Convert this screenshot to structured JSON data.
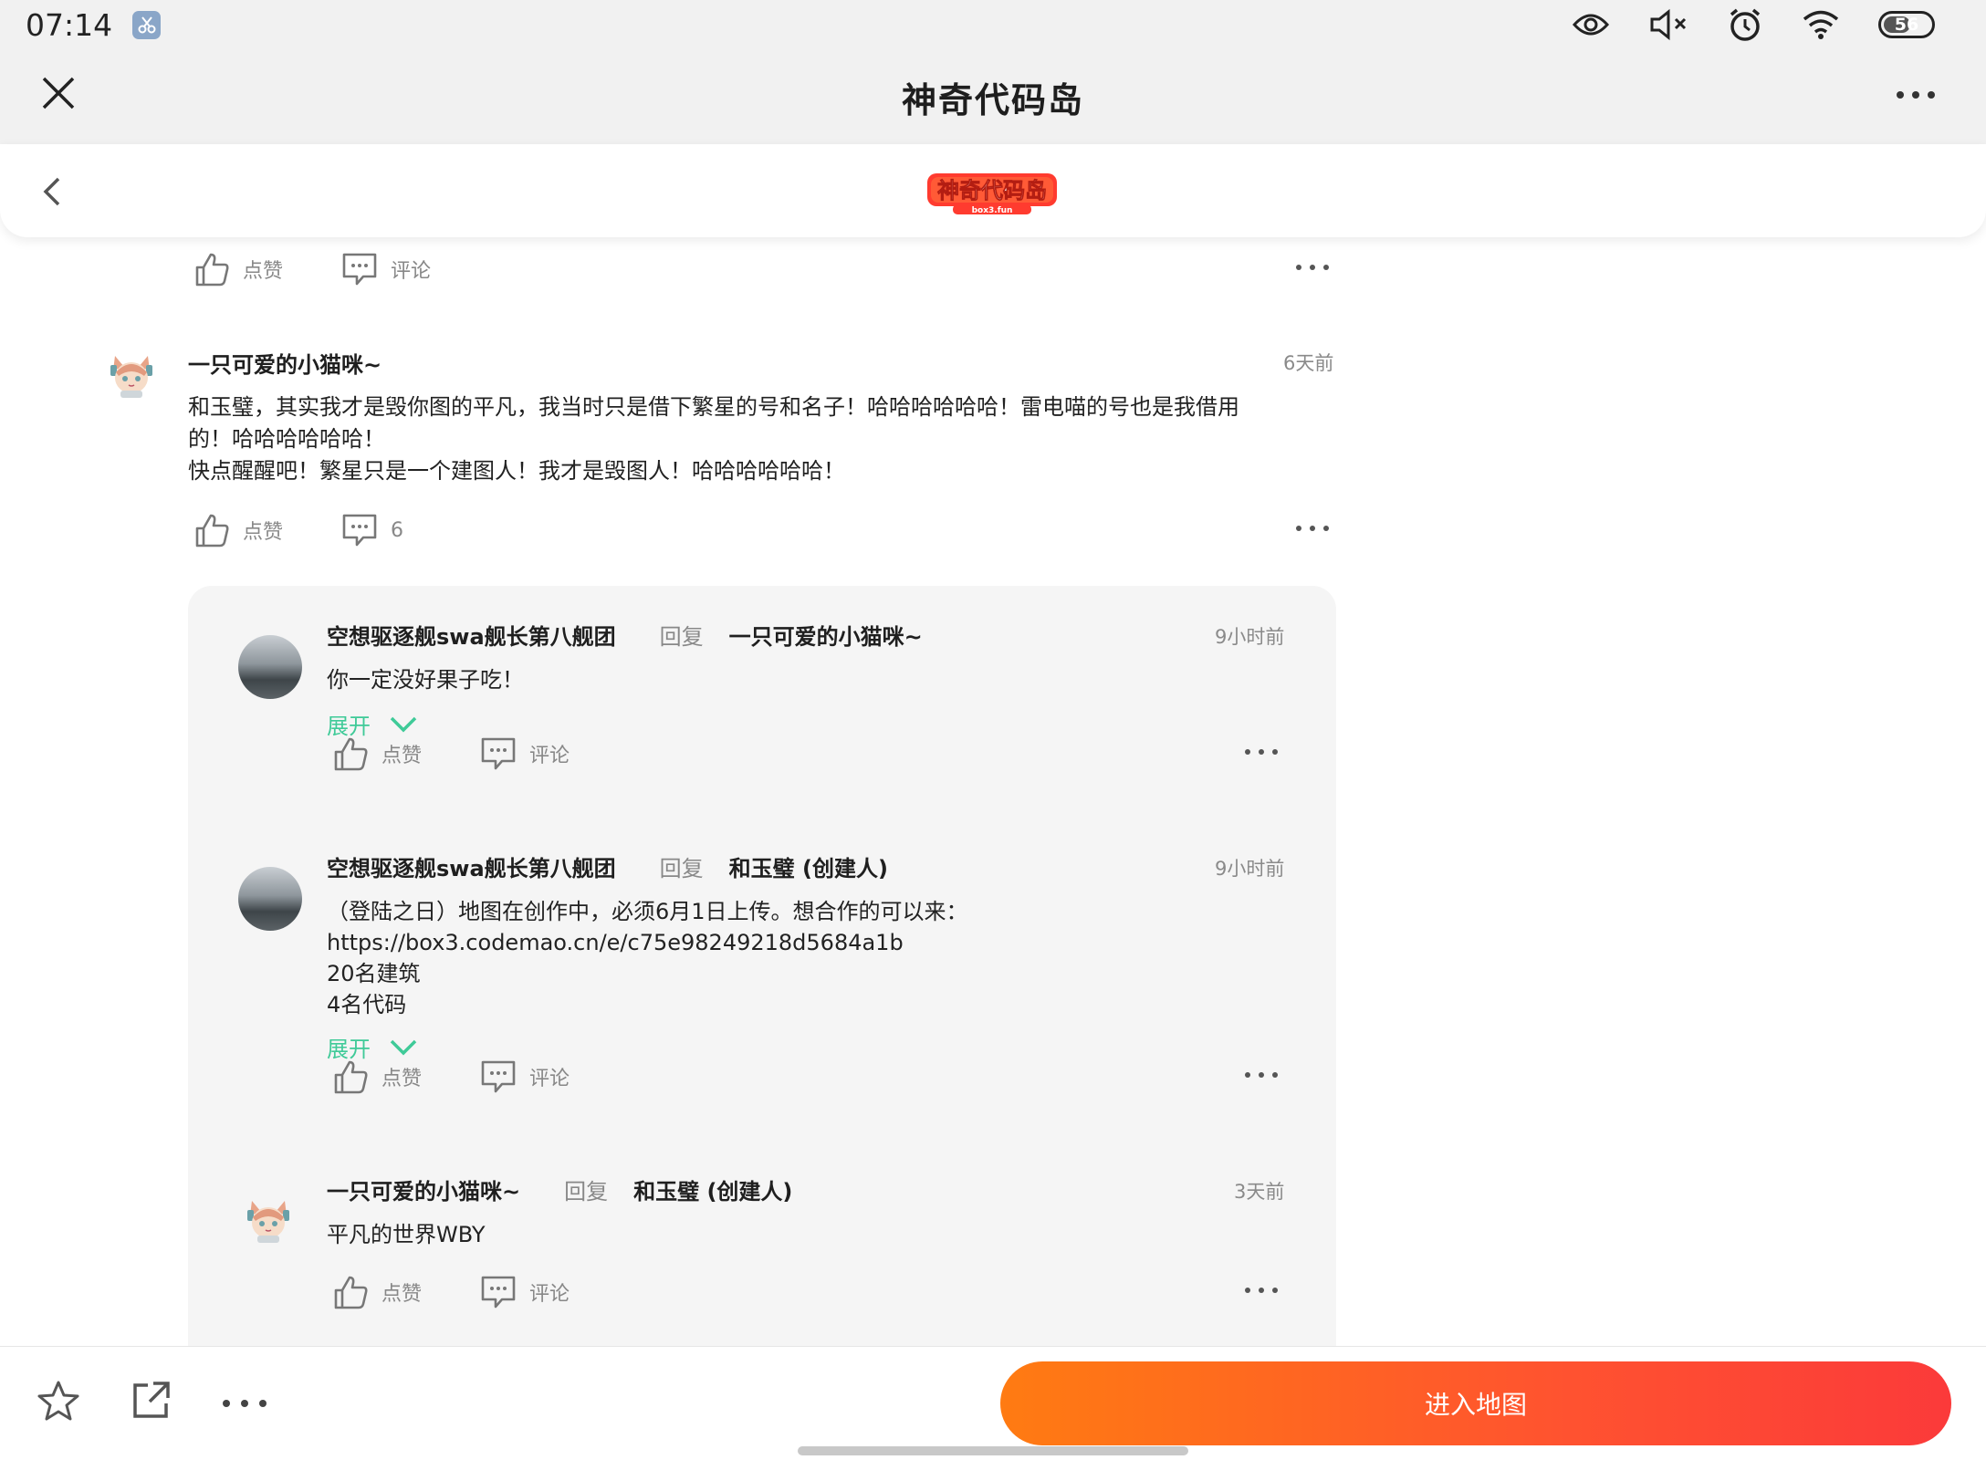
{
  "status": {
    "time": "07:14",
    "battery": "56"
  },
  "header": {
    "title": "神奇代码岛"
  },
  "logo": {
    "text": "神奇代码岛",
    "sub": "box3.fun"
  },
  "top_actions": {
    "like": "点赞",
    "comment": "评论"
  },
  "post": {
    "author": "一只可爱的小猫咪~",
    "time": "6天前",
    "text": "和玉璧，其实我才是毁你图的平凡，我当时只是借下繁星的号和名子！哈哈哈哈哈哈！雷电喵的号也是我借用\n的！哈哈哈哈哈哈！\n快点醒醒吧！繁星只是一个建图人！我才是毁图人！哈哈哈哈哈哈！",
    "like": "点赞",
    "comment_count": "6"
  },
  "replies": [
    {
      "author": "空想驱逐舰swa舰长第八舰团",
      "reply_word": "回复",
      "target": "一只可爱的小猫咪~",
      "time": "9小时前",
      "text": "你一定没好果子吃！",
      "expand": "展开",
      "like": "点赞",
      "comment": "评论"
    },
    {
      "author": "空想驱逐舰swa舰长第八舰团",
      "reply_word": "回复",
      "target": "和玉璧 (创建人)",
      "time": "9小时前",
      "text": "（登陆之日）地图在创作中，必须6月1日上传。想合作的可以来：\nhttps://box3.codemao.cn/e/c75e98249218d5684a1b\n20名建筑\n4名代码",
      "expand": "展开",
      "like": "点赞",
      "comment": "评论"
    },
    {
      "author": "一只可爱的小猫咪~",
      "reply_word": "回复",
      "target": "和玉璧 (创建人)",
      "time": "3天前",
      "text": "平凡的世界WBY",
      "like": "点赞",
      "comment": "评论"
    }
  ],
  "bottom": {
    "enter_label": "进入地图"
  },
  "colors": {
    "accent_green": "#3fca98",
    "button_start": "#ff7b12",
    "button_end": "#fb3a3a"
  }
}
